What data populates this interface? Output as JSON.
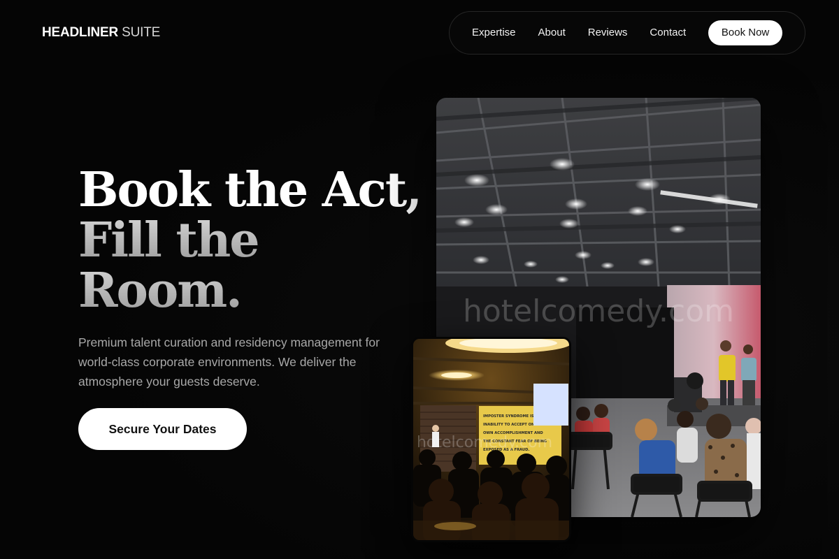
{
  "header": {
    "brand_bold": "HEADLINER",
    "brand_light": " SUITE",
    "nav": {
      "items": [
        "Expertise",
        "About",
        "Reviews",
        "Contact"
      ],
      "cta_label": "Book Now"
    }
  },
  "hero": {
    "headline_line1": "Book the Act,",
    "headline_line2": "Fill the",
    "headline_line3": "Room.",
    "subtext": "Premium talent curation and residency management for world-class corporate environments. We deliver the atmosphere your guests deserve.",
    "cta_label": "Secure Your Dates"
  },
  "images": {
    "main_watermark": "hotelcomedy.com",
    "small_watermark": "hotelcomedy.com",
    "screen_text": [
      "IMPOSTER SYNDROME IS THE",
      "INABILITY TO ACCEPT ONES",
      "OWN ACCOMPLISHMENT AND",
      "THE CONSTANT FEAR OF BEING",
      "EXPOSED AS A FRAUD."
    ]
  },
  "colors": {
    "background": "#050505",
    "accent": "#ffffff",
    "muted_text": "#a8a8a8"
  }
}
